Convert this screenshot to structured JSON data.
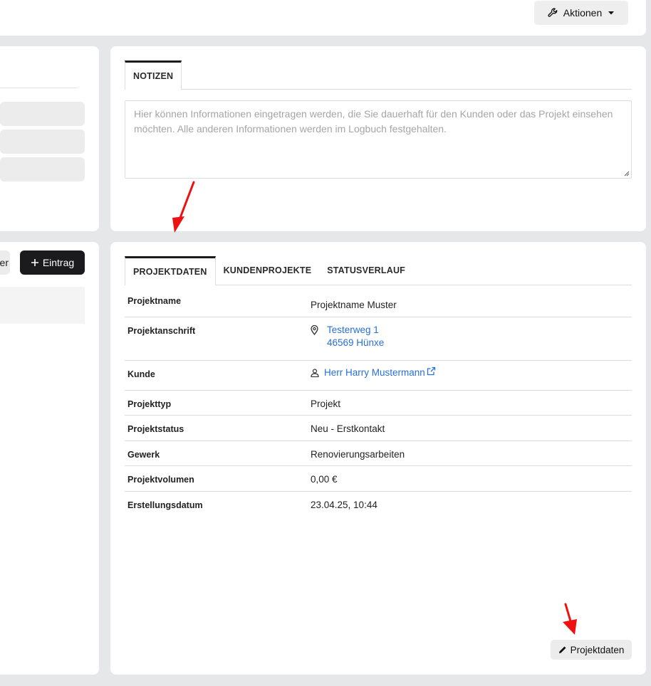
{
  "header": {
    "actions_label": "Aktionen"
  },
  "left_panel": {
    "cut_button_label": "er",
    "add_entry_label": "Eintrag"
  },
  "notes": {
    "tab_label": "NOTIZEN",
    "placeholder": "Hier können Informationen eingetragen werden, die Sie dauerhaft für den Kunden oder das Projekt einsehen möchten. Alle anderen Informationen werden im Logbuch festgehalten."
  },
  "project": {
    "tabs": [
      {
        "label": "PROJEKTDATEN",
        "active": true
      },
      {
        "label": "KUNDENPROJEKTE",
        "active": false
      },
      {
        "label": "STATUSVERLAUF",
        "active": false
      }
    ],
    "rows": {
      "name": {
        "label": "Projektname",
        "value": "Projektname Muster"
      },
      "address": {
        "label": "Projektanschrift",
        "line1": "Testerweg 1",
        "line2": "46569 Hünxe"
      },
      "customer": {
        "label": "Kunde",
        "value": "Herr Harry Mustermann"
      },
      "type": {
        "label": "Projekttyp",
        "value": "Projekt"
      },
      "status": {
        "label": "Projektstatus",
        "value": "Neu - Erstkontakt"
      },
      "trade": {
        "label": "Gewerk",
        "value": "Renovierungsarbeiten"
      },
      "volume": {
        "label": "Projektvolumen",
        "value": "0,00 €"
      },
      "created": {
        "label": "Erstellungsdatum",
        "value": "23.04.25, 10:44"
      }
    },
    "edit_button_label": "Projektdaten"
  },
  "colors": {
    "link": "#2a6fd6",
    "primary_dark": "#1b1b1d",
    "annotation_arrow": "#ee1111"
  }
}
